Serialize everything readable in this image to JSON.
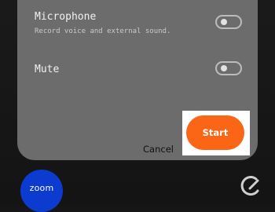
{
  "sheet": {
    "options": [
      {
        "title": "Microphone",
        "subtitle": "Record voice and external sound.",
        "enabled": false
      },
      {
        "title": "Mute",
        "subtitle": "",
        "enabled": false
      }
    ],
    "cancel_label": "Cancel",
    "start_label": "Start"
  },
  "background_app": {
    "label": "zoom",
    "icon": "zoom-app-icon"
  },
  "watermark": {
    "icon": "g-logo-icon"
  },
  "colors": {
    "sheet_bg": "#6c6c6c",
    "accent": "#fa6616",
    "zoom_blue": "#0b3ccf"
  }
}
